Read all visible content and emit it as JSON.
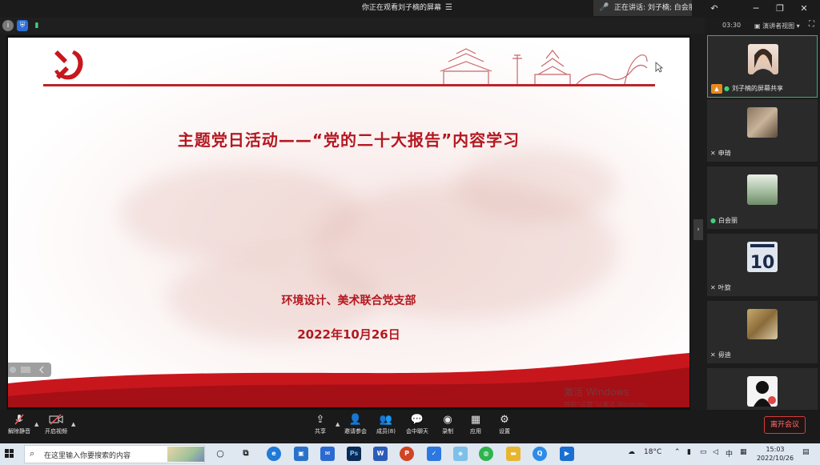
{
  "titlebar": {
    "viewing_text": "你正在观看刘子楠的屏幕",
    "speaking_text": "正在讲话: 刘子楠; 白会丽;"
  },
  "slide": {
    "title": "主题党日活动——“党的二十大报告”内容学习",
    "organization": "环境设计、美术联合党支部",
    "date": "2022年10月26日",
    "watermark_title": "激活 Windows",
    "watermark_sub": "转到“设置”以激活 Windows。"
  },
  "right_panel": {
    "timer": "03:30",
    "view_mode": "演讲者视图",
    "participants": [
      {
        "name": "刘子楠的屏幕共享",
        "sharing": true
      },
      {
        "name": "申琦",
        "sharing": false
      },
      {
        "name": "白会丽",
        "sharing": false
      },
      {
        "name": "叶旋",
        "sharing": false
      },
      {
        "name": "毋迪",
        "sharing": false
      },
      {
        "name": "",
        "sharing": false
      }
    ]
  },
  "toolbar": {
    "unmute": "解除静音",
    "start_video": "开启视频",
    "share": "共享",
    "invite": "邀请参会",
    "members": "成员(8)",
    "chat": "会中聊天",
    "record": "录制",
    "apps": "应用",
    "settings": "设置",
    "leave": "离开会议"
  },
  "taskbar": {
    "search_placeholder": "在这里输入你要搜索的内容",
    "temperature": "18°C",
    "ime": "中",
    "time": "15:03",
    "date": "2022/10/26"
  },
  "colors": {
    "slide_red": "#b41820",
    "active_green": "#2fb36a",
    "leave_red": "#d83b3b"
  }
}
